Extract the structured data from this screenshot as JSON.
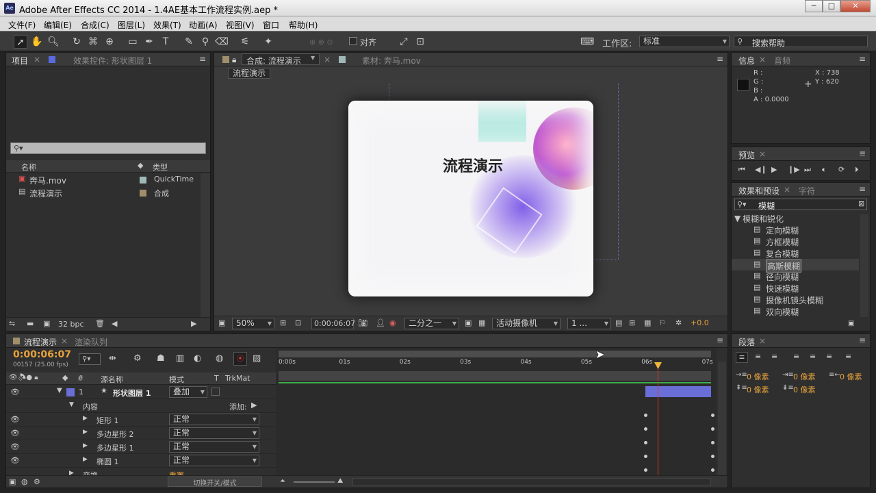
{
  "window": {
    "title": "Adobe After Effects CC 2014 - 1.4AE基本工作流程实例.aep *",
    "min": "─",
    "max": "□",
    "close": "✕"
  },
  "menu": [
    "文件(F)",
    "编辑(E)",
    "合成(C)",
    "图层(L)",
    "效果(T)",
    "动画(A)",
    "视图(V)",
    "窗口",
    "帮助(H)"
  ],
  "toolbar": {
    "align_label": "对齐",
    "workspace_label": "工作区:",
    "workspace_value": "标准",
    "search_help": "搜索帮助"
  },
  "project_panel": {
    "tab_project": "项目",
    "tab_effects": "效果控件: 形状图层 1",
    "col_name": "名称",
    "col_type": "类型",
    "items": [
      {
        "name": "奔马.mov",
        "type": "QuickTime",
        "swatch": "#9fb8b8"
      },
      {
        "name": "流程演示",
        "type": "合成",
        "swatch": "#a08f6a"
      }
    ],
    "bpc": "32 bpc"
  },
  "comp_panel": {
    "tab_comp": "合成: 流程演示",
    "tab_footage": "素材: 奔马.mov",
    "breadcrumb": "流程演示",
    "canvas_title": "流程演示",
    "zoom": "50%",
    "timecode": "0:00:06:07",
    "resolution": "二分之一",
    "camera": "活动摄像机",
    "views": "1 ...",
    "exposure": "+0.0"
  },
  "info_panel": {
    "tab_info": "信息",
    "tab_audio": "音频",
    "r_label": "R :",
    "g_label": "G :",
    "b_label": "B :",
    "a_label": "A : 0.0000",
    "x": "X : 738",
    "y": "Y : 620"
  },
  "preview_panel": {
    "tab": "预览"
  },
  "effects_panel": {
    "tab_effects": "效果和预设",
    "tab_char": "字符",
    "search_value": "模糊",
    "category": "模糊和锐化",
    "items": [
      "定向模糊",
      "方框模糊",
      "复合模糊",
      "高斯模糊",
      "径向模糊",
      "快速模糊",
      "摄像机镜头模糊",
      "双向模糊"
    ],
    "selected_index": 3
  },
  "paragraph_panel": {
    "tab": "段落",
    "row1": [
      "0 像素",
      "0 像素",
      "0 像素"
    ],
    "row2": [
      "0 像素",
      "0 像素"
    ]
  },
  "timeline": {
    "tab_comp": "流程演示",
    "tab_render": "渲染队列",
    "timecode": "0:00:06:07",
    "frames": "00157 (25.00 fps)",
    "col_source": "源名称",
    "col_mode": "模式",
    "col_t": "T",
    "col_trkmat": "TrkMat",
    "layer_num": "1",
    "layer_name": "形状图层 1",
    "layer_mode": "叠加",
    "contents": "内容",
    "add": "添加:",
    "sub_layers": [
      {
        "name": "矩形 1",
        "mode": "正常"
      },
      {
        "name": "多边星形 2",
        "mode": "正常"
      },
      {
        "name": "多边星形 1",
        "mode": "正常"
      },
      {
        "name": "椭圆 1",
        "mode": "正常"
      }
    ],
    "transform": "变换",
    "transform_value": "重置",
    "toggle_label": "切换开关/模式",
    "ruler": [
      "0:00s",
      "01s",
      "02s",
      "03s",
      "04s",
      "05s",
      "06s",
      "07s"
    ]
  },
  "colors": {
    "accent_orange": "#e6a23c",
    "layer_purple": "#6a6fd8",
    "timebar_green": "#3fb04a",
    "playhead_red": "#e0332b"
  }
}
